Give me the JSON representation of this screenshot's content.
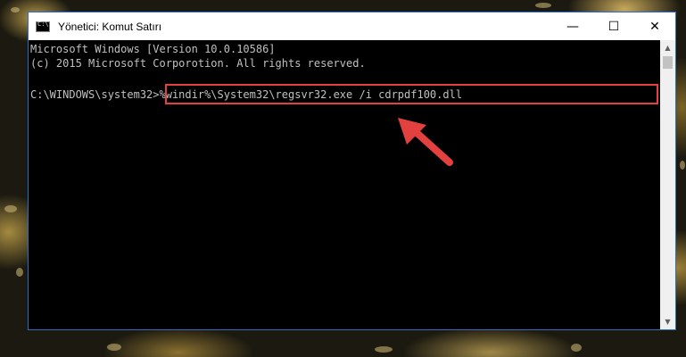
{
  "window": {
    "title": "Yönetici: Komut Satırı",
    "controls": {
      "minimize": "—",
      "maximize": "☐",
      "close": "✕"
    }
  },
  "console": {
    "line1": "Microsoft Windows [Version 10.0.10586]",
    "line2": "(c) 2015 Microsoft Corporotion. All rights reserved.",
    "prompt": "C:\\WINDOWS\\system32>",
    "command": "%windir%\\System32\\regsvr32.exe /i cdrpdf100.dll"
  },
  "scrollbar": {
    "up": "▲",
    "down": "▼"
  },
  "colors": {
    "highlight": "#e3413f",
    "window_border": "#2d6ec9",
    "console_text": "#c0c0c0"
  },
  "icons": [
    "cmd-app-icon",
    "red-arrow-icon",
    "scroll-up-arrow-icon",
    "scroll-down-arrow-icon"
  ]
}
